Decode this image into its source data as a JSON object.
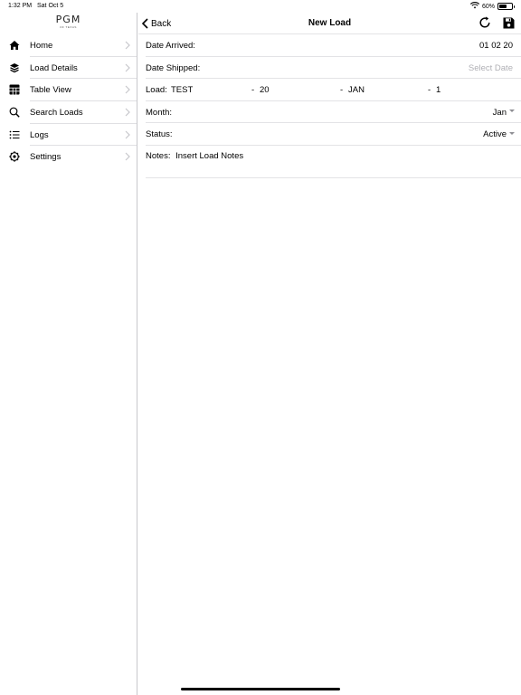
{
  "status_bar": {
    "time": "1:32 PM",
    "date": "Sat Oct 5",
    "battery": "60%",
    "battery_level": 0.6
  },
  "logo": {
    "text": "PGM",
    "sub": "OF TEXAS"
  },
  "sidebar": {
    "items": [
      {
        "label": "Home",
        "icon": "house-icon"
      },
      {
        "label": "Load Details",
        "icon": "layers-icon"
      },
      {
        "label": "Table View",
        "icon": "grid-icon"
      },
      {
        "label": "Search Loads",
        "icon": "search-icon"
      },
      {
        "label": "Logs",
        "icon": "list-icon"
      },
      {
        "label": "Settings",
        "icon": "gear-icon"
      }
    ]
  },
  "navbar": {
    "back_label": "Back",
    "title": "New Load",
    "refresh_icon": "refresh-icon",
    "save_icon": "save-icon"
  },
  "form": {
    "date_arrived": {
      "label": "Date Arrived:",
      "value": "01 02 20"
    },
    "date_shipped": {
      "label": "Date Shipped:",
      "placeholder": "Select Date"
    },
    "load": {
      "label": "Load:",
      "part1": "TEST",
      "sep": "-",
      "part2": "20",
      "part3": "JAN",
      "part4": "1"
    },
    "month": {
      "label": "Month:",
      "value": "Jan"
    },
    "status": {
      "label": "Status:",
      "value": "Active"
    },
    "notes": {
      "label": "Notes:",
      "value": "Insert Load Notes"
    }
  }
}
